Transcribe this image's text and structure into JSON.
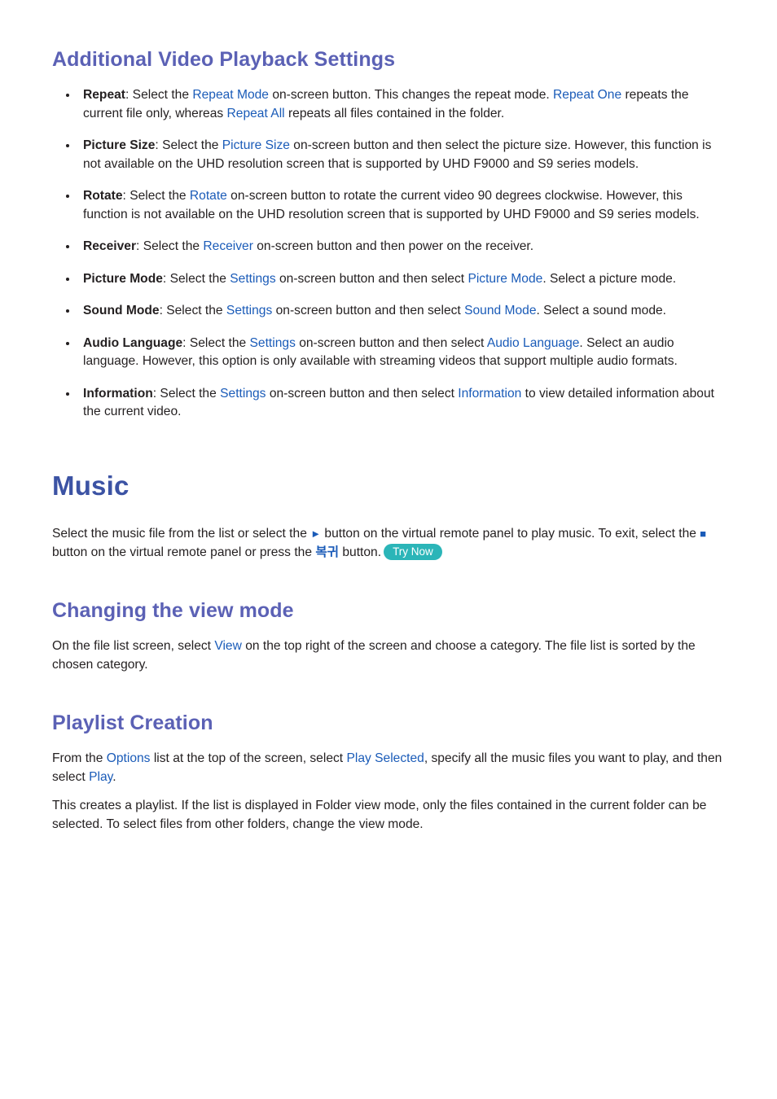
{
  "video_section": {
    "title": "Additional Video Playback Settings",
    "bullets": [
      {
        "term": "Repeat",
        "parts": [
          {
            "t": "text",
            "v": ": Select the "
          },
          {
            "t": "link",
            "v": "Repeat Mode"
          },
          {
            "t": "text",
            "v": " on-screen button. This changes the repeat mode. "
          },
          {
            "t": "link",
            "v": "Repeat One"
          },
          {
            "t": "text",
            "v": " repeats the current file only, whereas "
          },
          {
            "t": "link",
            "v": "Repeat All"
          },
          {
            "t": "text",
            "v": " repeats all files contained in the folder."
          }
        ]
      },
      {
        "term": "Picture Size",
        "parts": [
          {
            "t": "text",
            "v": ": Select the "
          },
          {
            "t": "link",
            "v": "Picture Size"
          },
          {
            "t": "text",
            "v": " on-screen button and then select the picture size. However, this function is not available on the UHD resolution screen that is supported by UHD F9000 and S9 series models."
          }
        ]
      },
      {
        "term": "Rotate",
        "parts": [
          {
            "t": "text",
            "v": ": Select the "
          },
          {
            "t": "link",
            "v": "Rotate"
          },
          {
            "t": "text",
            "v": " on-screen button to rotate the current video 90 degrees clockwise. However, this function is not available on the UHD resolution screen that is supported by UHD F9000 and S9 series models."
          }
        ]
      },
      {
        "term": "Receiver",
        "parts": [
          {
            "t": "text",
            "v": ": Select the "
          },
          {
            "t": "link",
            "v": "Receiver"
          },
          {
            "t": "text",
            "v": " on-screen button and then power on the receiver."
          }
        ]
      },
      {
        "term": "Picture Mode",
        "parts": [
          {
            "t": "text",
            "v": ": Select the "
          },
          {
            "t": "link",
            "v": "Settings"
          },
          {
            "t": "text",
            "v": " on-screen button and then select "
          },
          {
            "t": "link",
            "v": "Picture Mode"
          },
          {
            "t": "text",
            "v": ". Select a picture mode."
          }
        ]
      },
      {
        "term": "Sound Mode",
        "parts": [
          {
            "t": "text",
            "v": ": Select the "
          },
          {
            "t": "link",
            "v": "Settings"
          },
          {
            "t": "text",
            "v": " on-screen button and then select "
          },
          {
            "t": "link",
            "v": "Sound Mode"
          },
          {
            "t": "text",
            "v": ". Select a sound mode."
          }
        ]
      },
      {
        "term": "Audio Language",
        "parts": [
          {
            "t": "text",
            "v": ": Select the "
          },
          {
            "t": "link",
            "v": "Settings"
          },
          {
            "t": "text",
            "v": " on-screen button and then select "
          },
          {
            "t": "link",
            "v": "Audio Language"
          },
          {
            "t": "text",
            "v": ". Select an audio language. However, this option is only available with streaming videos that support multiple audio formats."
          }
        ]
      },
      {
        "term": "Information",
        "parts": [
          {
            "t": "text",
            "v": ": Select the "
          },
          {
            "t": "link",
            "v": "Settings"
          },
          {
            "t": "text",
            "v": " on-screen button and then select "
          },
          {
            "t": "link",
            "v": "Information"
          },
          {
            "t": "text",
            "v": " to view detailed information about the current video."
          }
        ]
      }
    ]
  },
  "music_chapter": {
    "title": "Music",
    "intro": {
      "parts": [
        {
          "t": "text",
          "v": "Select the music file from the list or select the "
        },
        {
          "t": "glyph",
          "v": "►"
        },
        {
          "t": "text",
          "v": " button on the virtual remote panel to play music. To exit, select the "
        },
        {
          "t": "glyph",
          "v": "■"
        },
        {
          "t": "text",
          "v": " button on the virtual remote panel or press the "
        },
        {
          "t": "kr",
          "v": "복귀"
        },
        {
          "t": "text",
          "v": " button."
        },
        {
          "t": "badge",
          "v": "Try Now"
        }
      ]
    },
    "view_mode": {
      "title": "Changing the view mode",
      "paragraphs": [
        {
          "parts": [
            {
              "t": "text",
              "v": "On the file list screen, select "
            },
            {
              "t": "link",
              "v": "View"
            },
            {
              "t": "text",
              "v": " on the top right of the screen and choose a category. The file list is sorted by the chosen category."
            }
          ]
        }
      ]
    },
    "playlist": {
      "title": "Playlist Creation",
      "paragraphs": [
        {
          "parts": [
            {
              "t": "text",
              "v": "From the "
            },
            {
              "t": "link",
              "v": "Options"
            },
            {
              "t": "text",
              "v": " list at the top of the screen, select "
            },
            {
              "t": "link",
              "v": "Play Selected"
            },
            {
              "t": "text",
              "v": ", specify all the music files you want to play, and then select "
            },
            {
              "t": "link",
              "v": "Play"
            },
            {
              "t": "text",
              "v": "."
            }
          ]
        },
        {
          "parts": [
            {
              "t": "text",
              "v": "This creates a playlist. If the list is displayed in Folder view mode, only the files contained in the current folder can be selected. To select files from other folders, change the view mode."
            }
          ]
        }
      ]
    }
  }
}
